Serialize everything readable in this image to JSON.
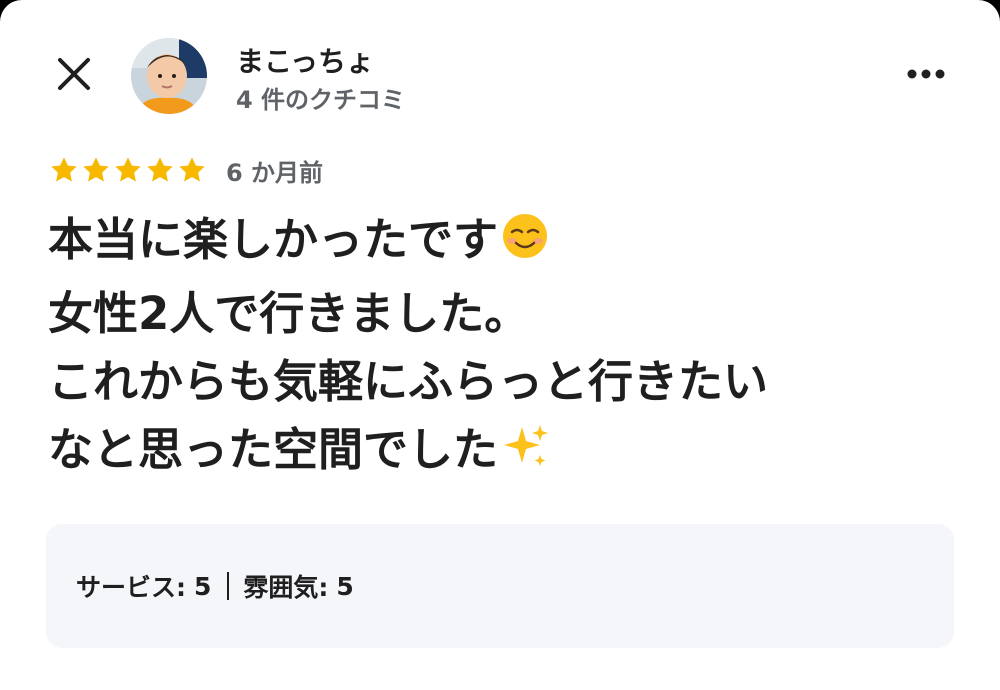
{
  "header": {
    "user_name": "まこっちょ",
    "review_count": "4 件のクチコミ",
    "icons": {
      "close": "close-icon",
      "more": "more-horizontal-icon",
      "avatar": "user-avatar-photo"
    }
  },
  "review": {
    "rating": 5,
    "rating_max": 5,
    "star_color": "#f6b900",
    "time_ago": "6 か月前",
    "lines": [
      "本当に楽しかったです",
      "女性2人で行きました。",
      "これからも気軽にふらっと行きたい",
      "なと思った空間でした"
    ],
    "emojis": {
      "line1": "smiling-face-emoji",
      "line4": "sparkles-emoji"
    }
  },
  "attributes": {
    "service_label": "サービス:",
    "service_value": "5",
    "atmosphere_label": "雰囲気:",
    "atmosphere_value": "5"
  }
}
